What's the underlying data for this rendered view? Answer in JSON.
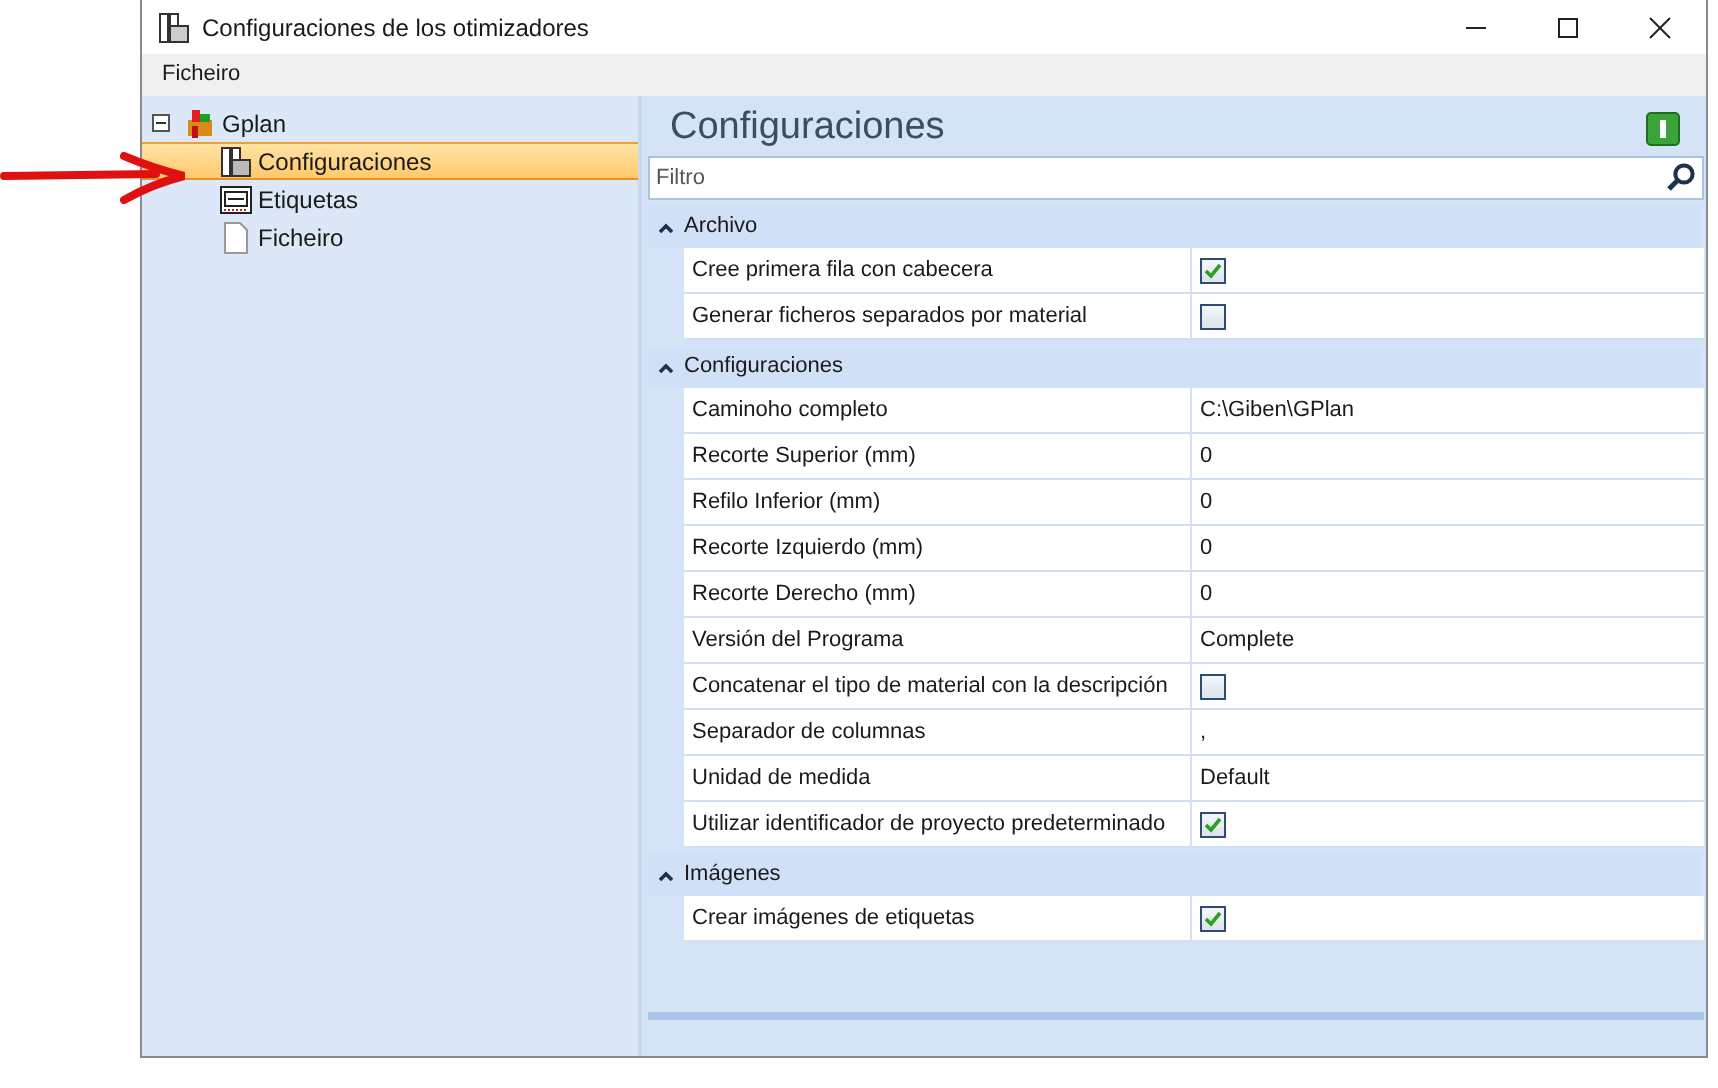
{
  "window": {
    "title": "Configuraciones de los otimizadores"
  },
  "menu": [
    "Ficheiro"
  ],
  "tree": [
    {
      "label": "Gplan",
      "expanded": true,
      "selected": false,
      "children": [
        {
          "label": "Configuraciones",
          "selected": true
        },
        {
          "label": "Etiquetas",
          "selected": false
        },
        {
          "label": "Ficheiro",
          "selected": false
        }
      ]
    }
  ],
  "panel": {
    "title": "Configuraciones",
    "filter": {
      "placeholder": "Filtro"
    }
  },
  "sections": [
    {
      "title": "Archivo",
      "expanded": true,
      "rows": [
        {
          "name": "Cree primera fila con cabecera",
          "kind": "checkbox",
          "checked": true
        },
        {
          "name": "Generar ficheros separados por material",
          "kind": "checkbox",
          "checked": false
        }
      ]
    },
    {
      "title": "Configuraciones",
      "expanded": true,
      "rows": [
        {
          "name": "Caminoho completo",
          "kind": "text",
          "value": "C:\\Giben\\GPlan"
        },
        {
          "name": "Recorte Superior (mm)",
          "kind": "text",
          "value": "0"
        },
        {
          "name": "Refilo Inferior (mm)",
          "kind": "text",
          "value": "0"
        },
        {
          "name": "Recorte Izquierdo (mm)",
          "kind": "text",
          "value": "0"
        },
        {
          "name": "Recorte Derecho (mm)",
          "kind": "text",
          "value": "0"
        },
        {
          "name": "Versión del Programa",
          "kind": "text",
          "value": "Complete"
        },
        {
          "name": "Concatenar el tipo de material con la descripción",
          "kind": "checkbox",
          "checked": false
        },
        {
          "name": "Separador de columnas",
          "kind": "text",
          "value": ","
        },
        {
          "name": "Unidad de medida",
          "kind": "text",
          "value": "Default"
        },
        {
          "name": "Utilizar identificador de proyecto predeterminado",
          "kind": "checkbox",
          "checked": true
        }
      ]
    },
    {
      "title": "Imágenes",
      "expanded": true,
      "rows": [
        {
          "name": "Crear imágenes de etiquetas",
          "kind": "checkbox",
          "checked": true
        }
      ]
    }
  ]
}
